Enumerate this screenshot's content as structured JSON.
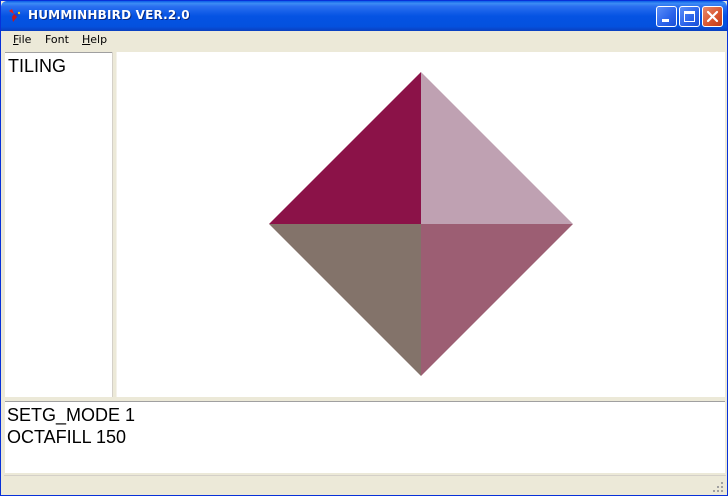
{
  "window": {
    "title": "HUMMINHBIRD VER.2.0",
    "colors": {
      "titlebar": "#0553e3",
      "close_button": "#d8532c"
    }
  },
  "menu": {
    "items": [
      {
        "label": "File"
      },
      {
        "label": "Font"
      },
      {
        "label": "Help"
      }
    ]
  },
  "left_panel": {
    "label": "TILING"
  },
  "canvas": {
    "shape": "diamond",
    "quadrants": {
      "top_left": "#8b1248",
      "top_right": "#bfa1b2",
      "bottom_left": "#83736a",
      "bottom_right": "#9c5e73"
    }
  },
  "console": {
    "lines": [
      "SETG_MODE 1",
      "OCTAFILL 150"
    ]
  },
  "icons": {
    "app": "hummingbird-app-icon",
    "minimize": "minimize-icon",
    "maximize": "maximize-icon",
    "close": "close-icon"
  }
}
